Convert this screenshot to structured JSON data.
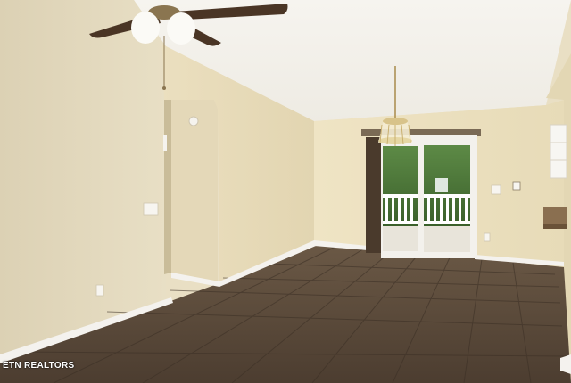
{
  "photo": {
    "subject": "empty-room-interior",
    "watermark": "ETN REALTORS"
  },
  "palette": {
    "wall_left": "#e6dcc0",
    "wall_mid": "#e9ddb9",
    "wall_back": "#ece0bd",
    "ceiling": "#f3f0ea",
    "floor": "#5a4a3a",
    "baseboard": "#f4f2ee",
    "curtain": "#4a3a2c",
    "greenery": "#3f6a2e"
  }
}
